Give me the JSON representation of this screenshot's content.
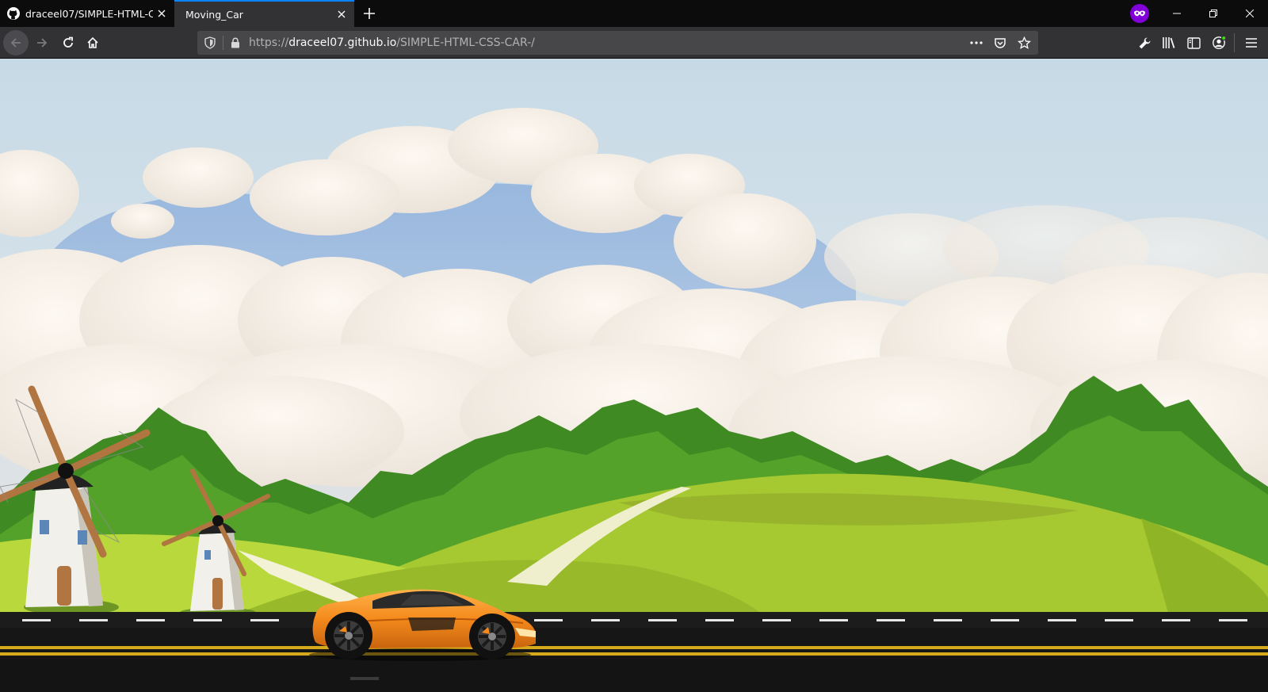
{
  "browser": {
    "tabs": [
      {
        "label": "draceel07/SIMPLE-HTML-CSS-(",
        "icon": "github-icon",
        "active": false
      },
      {
        "label": "Moving_Car",
        "icon": "none",
        "active": true
      }
    ],
    "url": {
      "scheme": "https://",
      "host": "draceel07.github.io",
      "path": "/SIMPLE-HTML-CSS-CAR-/"
    },
    "colors": {
      "chrome_dark": "#0c0c0d",
      "toolbar": "#323234",
      "urlbar": "#474749",
      "active_tab_accent": "#0a84ff",
      "private_badge": "#8000d7"
    }
  },
  "scene": {
    "description_icons": [
      "windmill-large",
      "windmill-small",
      "orange-sports-car",
      "road",
      "clouds",
      "hills",
      "trees"
    ],
    "colors": {
      "sky": "#c9dbe6",
      "cloud": "#f4ede4",
      "tree_dark": "#3f8a22",
      "tree_light": "#58a62c",
      "hill_light": "#a6c931",
      "hill_mid": "#8fb527",
      "path": "#f3f1d6",
      "road": "#161616",
      "road_line_yellow": "#d6a91c",
      "road_dash": "#e8e8e8",
      "car_body": "#f48a1c",
      "windmill_wall": "#f2f0ea",
      "windmill_blade": "#b07540"
    }
  }
}
